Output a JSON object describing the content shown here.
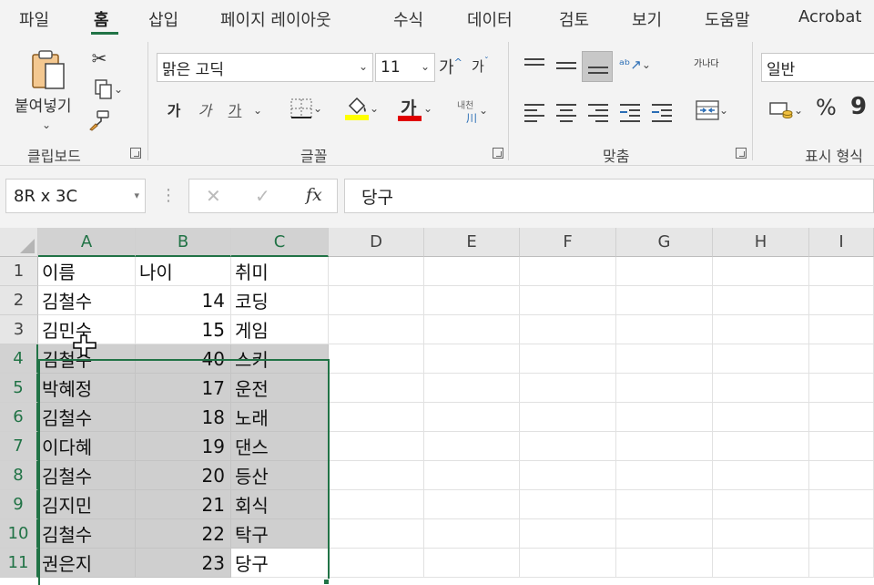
{
  "ribbon_tabs": [
    {
      "label": "파일",
      "active": false
    },
    {
      "label": "홈",
      "active": true
    },
    {
      "label": "삽입",
      "active": false
    },
    {
      "label": "페이지 레이아웃",
      "active": false
    },
    {
      "label": "수식",
      "active": false
    },
    {
      "label": "데이터",
      "active": false
    },
    {
      "label": "검토",
      "active": false
    },
    {
      "label": "보기",
      "active": false
    },
    {
      "label": "도움말",
      "active": false
    },
    {
      "label": "Acrobat",
      "active": false
    }
  ],
  "clipboard": {
    "paste_label": "붙여넣기",
    "group_label": "클립보드"
  },
  "font": {
    "font_name": "맑은 고딕",
    "font_size": "11",
    "grow_label": "가",
    "shrink_label": "가",
    "bold_label": "가",
    "italic_label": "가",
    "underline_label": "가",
    "font_color_label": "가",
    "phonetic_label": "내천",
    "group_label": "글꼴",
    "highlight_color": "#ffff00",
    "font_color": "#e00000"
  },
  "alignment": {
    "wrap_label": "가나다",
    "group_label": "맞춤"
  },
  "number": {
    "format": "일반",
    "percent_label": "%",
    "comma_label": "9",
    "group_label": "표시 형식"
  },
  "formula_bar": {
    "name_box": "8R x 3C",
    "cancel_icon": "✕",
    "enter_icon": "✓",
    "fx_label": "fx",
    "formula": "당구"
  },
  "grid": {
    "columns": [
      "A",
      "B",
      "C",
      "D",
      "E",
      "F",
      "G",
      "H",
      "I"
    ],
    "rows": [
      "1",
      "2",
      "3",
      "4",
      "5",
      "6",
      "7",
      "8",
      "9",
      "10",
      "11"
    ],
    "cells": [
      [
        "이름",
        "나이",
        "취미"
      ],
      [
        "김철수",
        "14",
        "코딩"
      ],
      [
        "김민수",
        "15",
        "게임"
      ],
      [
        "김철수",
        "40",
        "스키"
      ],
      [
        "박혜정",
        "17",
        "운전"
      ],
      [
        "김철수",
        "18",
        "노래"
      ],
      [
        "이다혜",
        "19",
        "댄스"
      ],
      [
        "김철수",
        "20",
        "등산"
      ],
      [
        "김지민",
        "21",
        "회식"
      ],
      [
        "김철수",
        "22",
        "탁구"
      ],
      [
        "권은지",
        "23",
        "당구"
      ]
    ],
    "accent_color": "#217346"
  }
}
